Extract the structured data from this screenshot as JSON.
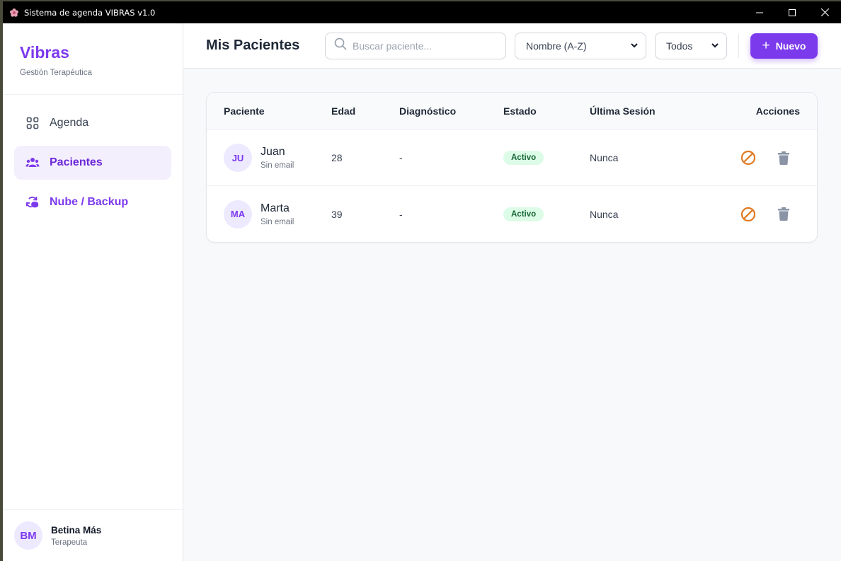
{
  "window": {
    "title": "Sistema de agenda VIBRAS v1.0"
  },
  "sidebar": {
    "brand": "Vibras",
    "subtitle": "Gestión Terapéutica",
    "items": [
      {
        "label": "Agenda",
        "icon": "grid-icon"
      },
      {
        "label": "Pacientes",
        "icon": "users-icon"
      },
      {
        "label": "Nube / Backup",
        "icon": "cloud-sync-icon"
      }
    ],
    "user": {
      "initials": "BM",
      "name": "Betina Más",
      "role": "Terapeuta"
    }
  },
  "header": {
    "title": "Mis Pacientes",
    "search_placeholder": "Buscar paciente...",
    "sort_value": "Nombre (A-Z)",
    "filter_value": "Todos",
    "new_label": "Nuevo"
  },
  "table": {
    "columns": [
      "Paciente",
      "Edad",
      "Diagnóstico",
      "Estado",
      "Última Sesión",
      "Acciones"
    ],
    "rows": [
      {
        "initials": "JU",
        "name": "Juan",
        "email": "Sin email",
        "age": "28",
        "diagnosis": "-",
        "status": "Activo",
        "last_session": "Nunca"
      },
      {
        "initials": "MA",
        "name": "Marta",
        "email": "Sin email",
        "age": "39",
        "diagnosis": "-",
        "status": "Activo",
        "last_session": "Nunca"
      }
    ]
  },
  "colors": {
    "accent": "#7c3aed",
    "active_badge_bg": "#dcfce7",
    "active_badge_text": "#166534",
    "deactivate_icon": "#e07b24",
    "delete_icon": "#8a94a6"
  }
}
